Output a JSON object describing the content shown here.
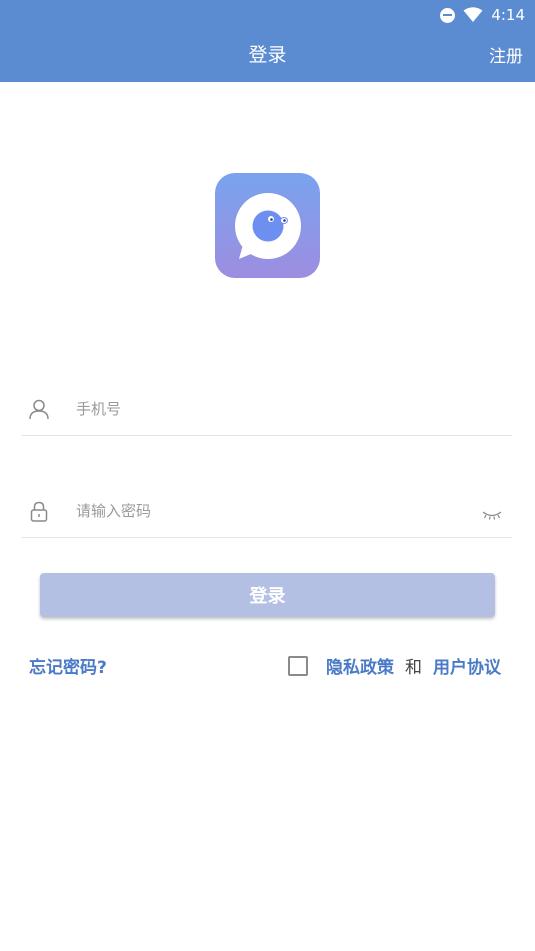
{
  "status_bar": {
    "time": "4:14",
    "icons": [
      "do-not-disturb-icon",
      "wifi-icon"
    ]
  },
  "header": {
    "title": "登录",
    "register_label": "注册"
  },
  "phone_field": {
    "placeholder": "手机号",
    "value": "",
    "icon": "user-icon"
  },
  "password_field": {
    "placeholder": "请输入密码",
    "value": "",
    "icon": "lock-icon",
    "toggle_icon": "eye-closed-icon"
  },
  "login_button": {
    "label": "登录"
  },
  "footer": {
    "forgot_label": "忘记密码?",
    "privacy_label": "隐私政策",
    "and_label": "和",
    "terms_label": "用户协议",
    "agree_checked": false
  },
  "colors": {
    "header_bg": "#5b8bd0",
    "accent": "#4b7bc6",
    "button_disabled": "#b3c0e4"
  }
}
